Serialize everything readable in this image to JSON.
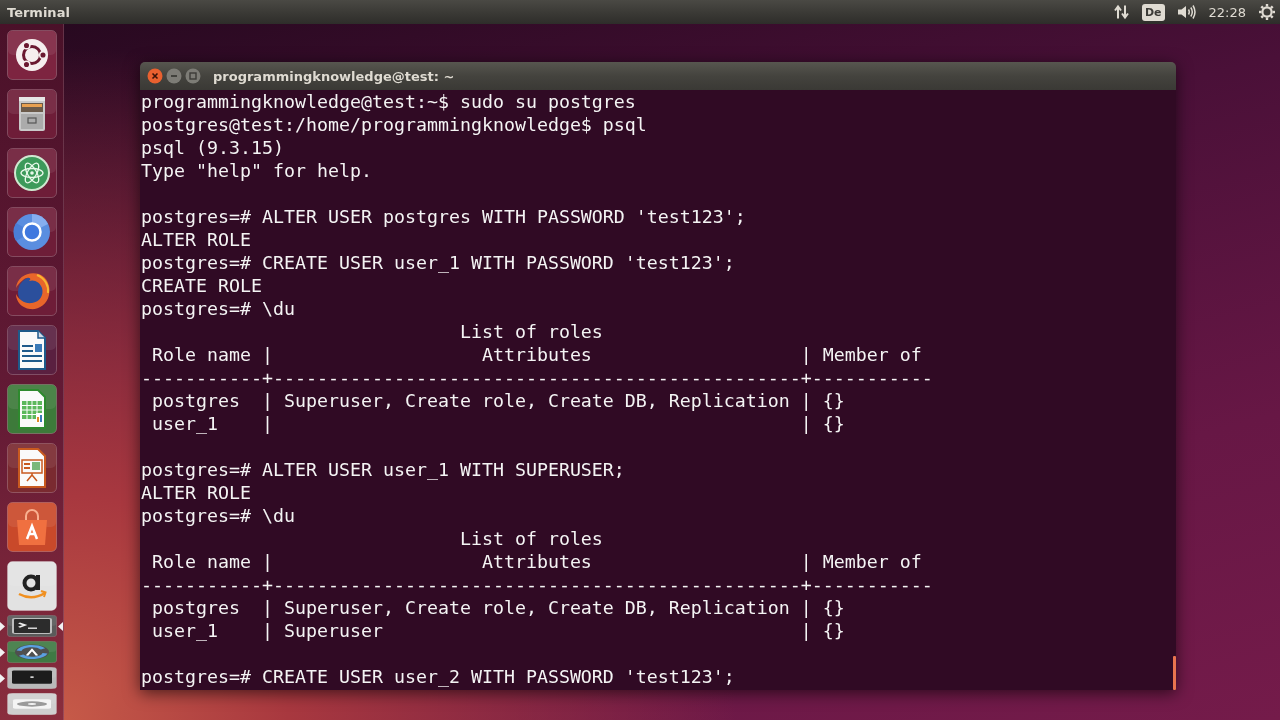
{
  "top_panel": {
    "app_title": "Terminal",
    "keyboard_layout": "De",
    "clock": "22:28"
  },
  "launcher": {
    "items": [
      {
        "kind": "dash",
        "running": false,
        "focused": false,
        "folded": false
      },
      {
        "kind": "files",
        "running": false,
        "focused": false,
        "folded": false
      },
      {
        "kind": "atom",
        "running": false,
        "focused": false,
        "folded": false
      },
      {
        "kind": "chromium",
        "running": false,
        "focused": false,
        "folded": false
      },
      {
        "kind": "firefox",
        "running": false,
        "focused": false,
        "folded": false
      },
      {
        "kind": "writer",
        "running": false,
        "focused": false,
        "folded": false
      },
      {
        "kind": "calc",
        "running": false,
        "focused": false,
        "folded": false
      },
      {
        "kind": "impress",
        "running": false,
        "focused": false,
        "folded": false
      },
      {
        "kind": "software",
        "running": false,
        "focused": false,
        "folded": false
      },
      {
        "kind": "amazon",
        "running": false,
        "focused": false,
        "folded": false
      },
      {
        "kind": "terminal",
        "running": true,
        "focused": true,
        "folded": true
      },
      {
        "kind": "updater",
        "running": true,
        "focused": false,
        "folded": true
      },
      {
        "kind": "display",
        "running": true,
        "focused": false,
        "folded": true
      },
      {
        "kind": "dvd",
        "running": false,
        "focused": false,
        "folded": true
      }
    ]
  },
  "terminal_window": {
    "title": "programmingknowledge@test: ~",
    "blocks": [
      {
        "lines": [
          "programmingknowledge@test:~$ sudo su postgres",
          "postgres@test:/home/programmingknowledge$ psql",
          "psql (9.3.15)",
          "Type \"help\" for help."
        ]
      },
      {
        "lines": [
          "postgres=# ALTER USER postgres WITH PASSWORD 'test123';",
          "ALTER ROLE",
          "postgres=# CREATE USER user_1 WITH PASSWORD 'test123';",
          "CREATE ROLE",
          "postgres=# \\du",
          "                             List of roles",
          " Role name |                   Attributes                   | Member of",
          "-----------+------------------------------------------------+-----------",
          " postgres  | Superuser, Create role, Create DB, Replication | {}",
          " user_1    |                                                | {}"
        ]
      },
      {
        "lines": [
          "postgres=# ALTER USER user_1 WITH SUPERUSER;",
          "ALTER ROLE",
          "postgres=# \\du",
          "                             List of roles",
          " Role name |                   Attributes                   | Member of",
          "-----------+------------------------------------------------+-----------",
          " postgres  | Superuser, Create role, Create DB, Replication | {}",
          " user_1    | Superuser                                      | {}"
        ]
      },
      {
        "lines": [
          "postgres=# CREATE USER user_2 WITH PASSWORD 'test123';"
        ]
      }
    ]
  }
}
